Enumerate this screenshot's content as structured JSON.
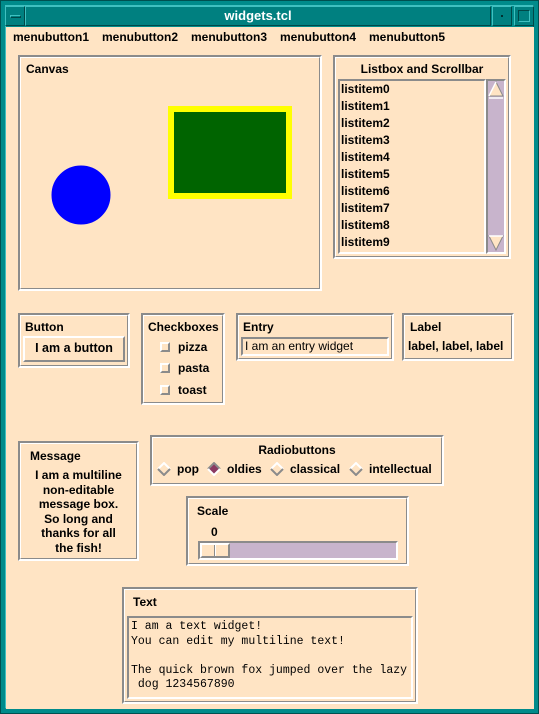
{
  "window": {
    "title": "widgets.tcl",
    "colors": {
      "frame": "#008b8b",
      "background": "#ffe4c4",
      "trough": "#c8b4cc"
    }
  },
  "menubar": {
    "items": [
      "menubutton1",
      "menubutton2",
      "menubutton3",
      "menubutton4",
      "menubutton5"
    ]
  },
  "canvas": {
    "label": "Canvas",
    "shapes": [
      {
        "kind": "oval",
        "fill": "#0000ff",
        "outline": "#0000ff"
      },
      {
        "kind": "rectangle",
        "fill": "#006400",
        "outline": "#ffff00"
      }
    ]
  },
  "listbox": {
    "label": "Listbox and Scrollbar",
    "items": [
      "listitem0",
      "listitem1",
      "listitem2",
      "listitem3",
      "listitem4",
      "listitem5",
      "listitem6",
      "listitem7",
      "listitem8",
      "listitem9"
    ],
    "scrollbar": {
      "up_icon": "arrow-up",
      "down_icon": "arrow-down"
    }
  },
  "button": {
    "label": "Button",
    "text": "I am a button"
  },
  "checkboxes": {
    "label": "Checkboxes",
    "items": [
      {
        "label": "pizza",
        "checked": false
      },
      {
        "label": "pasta",
        "checked": false
      },
      {
        "label": "toast",
        "checked": false
      }
    ]
  },
  "entry": {
    "label": "Entry",
    "value": "I am an entry widget"
  },
  "label_widget": {
    "label": "Label",
    "text": "label, label, label"
  },
  "message": {
    "label": "Message",
    "lines": [
      "I am a multiline",
      "non-editable",
      "message box.",
      "So long and",
      "thanks for all",
      "the fish!"
    ]
  },
  "radiobuttons": {
    "label": "Radiobuttons",
    "items": [
      {
        "label": "pop",
        "selected": false
      },
      {
        "label": "oldies",
        "selected": true
      },
      {
        "label": "classical",
        "selected": false
      },
      {
        "label": "intellectual",
        "selected": false
      }
    ],
    "selected_color": "#8b3a62"
  },
  "scale": {
    "label": "Scale",
    "value": "0",
    "fraction": 0.0
  },
  "text": {
    "label": "Text",
    "content": "I am a text widget!\nYou can edit my multiline text!\n\nThe quick brown fox jumped over the lazy\n dog 1234567890"
  }
}
